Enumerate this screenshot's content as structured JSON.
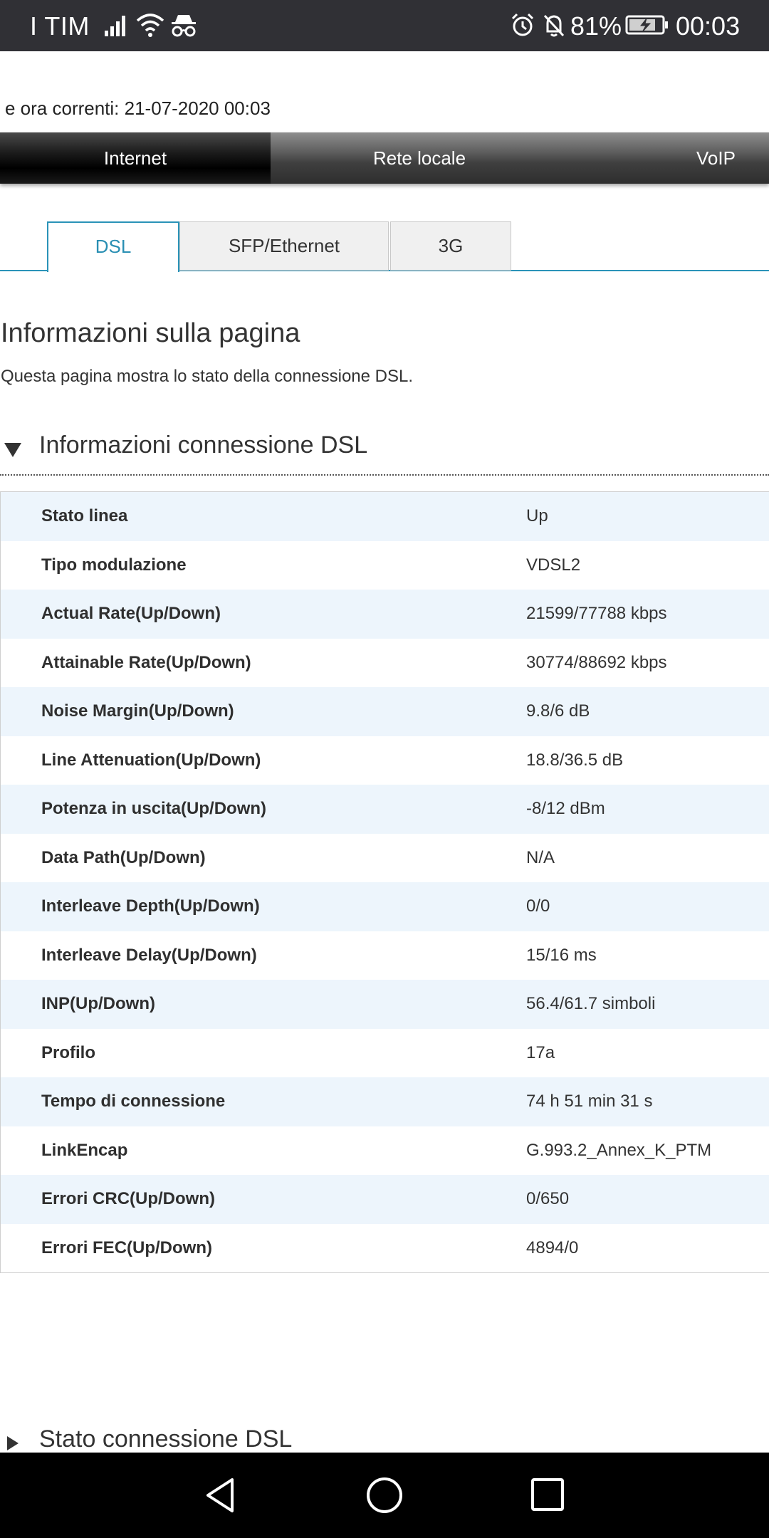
{
  "status_bar": {
    "carrier": "I TIM",
    "battery_percent": "81%",
    "clock": "00:03",
    "icons": [
      "signal-icon",
      "wifi-icon",
      "incognito-icon",
      "alarm-icon",
      "notifications-off-icon",
      "battery-charging-icon"
    ]
  },
  "page": {
    "datetime_text": "e ora correnti: 21-07-2020 00:03",
    "main_nav": {
      "items": [
        {
          "label": "Internet",
          "active": true
        },
        {
          "label": "Rete locale",
          "active": false
        },
        {
          "label": "VoIP",
          "active": false
        }
      ]
    },
    "sub_tabs": [
      {
        "label": "DSL",
        "active": true
      },
      {
        "label": "SFP/Ethernet",
        "active": false
      },
      {
        "label": "3G",
        "active": false
      }
    ],
    "info": {
      "title": "Informazioni sulla pagina",
      "description": "Questa pagina mostra lo stato della connessione DSL."
    },
    "section": {
      "title": "Informazioni connessione DSL",
      "rows": [
        {
          "label": "Stato linea",
          "value": "Up"
        },
        {
          "label": "Tipo modulazione",
          "value": "VDSL2"
        },
        {
          "label": "Actual Rate(Up/Down)",
          "value": "21599/77788 kbps"
        },
        {
          "label": "Attainable Rate(Up/Down)",
          "value": "30774/88692 kbps"
        },
        {
          "label": "Noise Margin(Up/Down)",
          "value": "9.8/6 dB"
        },
        {
          "label": "Line Attenuation(Up/Down)",
          "value": "18.8/36.5 dB"
        },
        {
          "label": "Potenza in uscita(Up/Down)",
          "value": "-8/12 dBm"
        },
        {
          "label": "Data Path(Up/Down)",
          "value": "N/A"
        },
        {
          "label": "Interleave Depth(Up/Down)",
          "value": "0/0"
        },
        {
          "label": "Interleave Delay(Up/Down)",
          "value": "15/16 ms"
        },
        {
          "label": "INP(Up/Down)",
          "value": "56.4/61.7 simboli"
        },
        {
          "label": "Profilo",
          "value": "17a"
        },
        {
          "label": "Tempo di connessione",
          "value": "74 h 51 min 31 s"
        },
        {
          "label": "LinkEncap",
          "value": "G.993.2_Annex_K_PTM"
        },
        {
          "label": "Errori CRC(Up/Down)",
          "value": "0/650"
        },
        {
          "label": "Errori FEC(Up/Down)",
          "value": "4894/0"
        }
      ]
    },
    "section2": {
      "title": "Stato connessione DSL"
    }
  },
  "colors": {
    "accent": "#2a93b8",
    "row_alt": "#edf5fc",
    "status_bar": "#303035"
  }
}
